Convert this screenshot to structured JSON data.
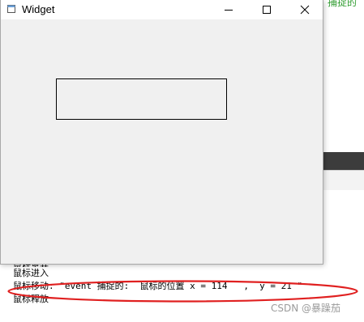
{
  "background": {
    "green_text": "捕捉的",
    "output_lines": [
      "鼠标离开",
      "鼠标进入",
      "鼠标移动: \"event 捕捉的:  鼠标的位置 x = 114   ,  y = 21 \"",
      "鼠标释放"
    ],
    "watermark": "CSDN @暴躁茄"
  },
  "window": {
    "title": "Widget",
    "controls": {
      "minimize": "minimize-icon",
      "maximize": "maximize-icon",
      "close": "close-icon"
    }
  },
  "colors": {
    "highlight_ellipse": "#e02020",
    "window_bg": "#f0f0f0",
    "green_text": "#2e9b2e"
  }
}
